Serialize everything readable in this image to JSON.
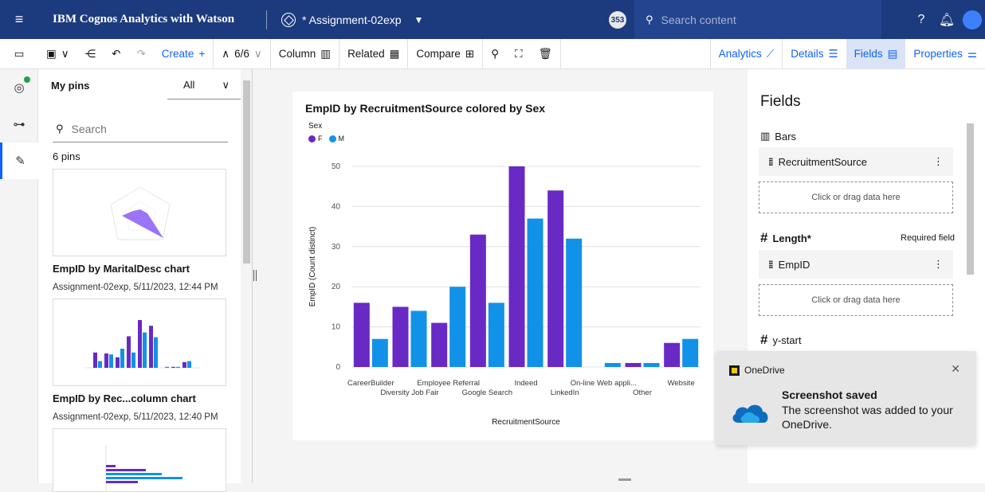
{
  "header": {
    "brand": "IBM Cognos Analytics with Watson",
    "document": "* Assignment-02exp",
    "badge": "353",
    "search_placeholder": "Search content"
  },
  "toolbar": {
    "create": "Create",
    "page_counter": "6/6",
    "column": "Column",
    "related": "Related",
    "compare": "Compare",
    "analytics": "Analytics",
    "details": "Details",
    "fields": "Fields",
    "properties": "Properties"
  },
  "pins": {
    "title": "My pins",
    "filter": "All",
    "search_placeholder": "Search",
    "count": "6 pins",
    "items": [
      {
        "name": "EmpID by MaritalDesc chart",
        "meta": "Assignment-02exp, 5/11/2023, 12:44 PM"
      },
      {
        "name": "EmpID by Rec...column chart",
        "meta": "Assignment-02exp, 5/11/2023, 12:40 PM"
      }
    ]
  },
  "fields": {
    "title": "Fields",
    "bars_label": "Bars",
    "bars_item": "RecruitmentSource",
    "drop_label": "Click or drag data here",
    "length_label": "Length*",
    "required": "Required field",
    "length_item": "EmpID",
    "ystart_label": "y-start"
  },
  "toast": {
    "app": "OneDrive",
    "title": "Screenshot saved",
    "body": "The screenshot was added to your OneDrive."
  },
  "colors": {
    "F": "#6929c4",
    "M": "#1192e8",
    "header": "#1c3a7e"
  },
  "chart_data": {
    "type": "bar",
    "title": "EmpID by RecruitmentSource colored by Sex",
    "xlabel": "RecruitmentSource",
    "ylabel": "EmpID (Count distinct)",
    "legend_title": "Sex",
    "ylim": [
      0,
      50
    ],
    "yticks": [
      0,
      10,
      20,
      30,
      40,
      50
    ],
    "categories": [
      "CareerBuilder",
      "Diversity Job Fair",
      "Employee Referral",
      "Google Search",
      "Indeed",
      "LinkedIn",
      "On-line Web appli...",
      "Other",
      "Website"
    ],
    "series": [
      {
        "name": "F",
        "values": [
          16,
          15,
          11,
          33,
          50,
          44,
          0,
          1,
          6
        ]
      },
      {
        "name": "M",
        "values": [
          7,
          14,
          20,
          16,
          37,
          32,
          1,
          1,
          7
        ]
      }
    ]
  }
}
